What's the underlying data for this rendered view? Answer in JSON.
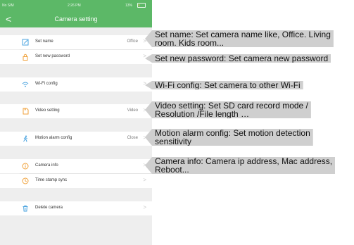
{
  "status_bar": {
    "carrier": "No SIM",
    "time": "2:26 PM",
    "battery": "13%",
    "battery_level": 0.13
  },
  "nav": {
    "back": "<",
    "title": "Camera setting"
  },
  "rows": [
    {
      "icon": "edit-icon",
      "label": "Set name",
      "value": "Office"
    },
    {
      "icon": "lock-icon",
      "label": "Set new password",
      "value": ""
    },
    {
      "icon": "wifi-icon",
      "label": "Wi-Fi config",
      "value": ""
    },
    {
      "icon": "sd-card-icon",
      "label": "Video setting",
      "value": "Video"
    },
    {
      "icon": "motion-icon",
      "label": "Motion alarm config",
      "value": "Close"
    },
    {
      "icon": "info-icon",
      "label": "Camera info",
      "value": ""
    },
    {
      "icon": "clock-icon",
      "label": "Time stamp sync",
      "value": ""
    },
    {
      "icon": "trash-icon",
      "label": "Delete camera",
      "value": ""
    }
  ],
  "chevron": ">",
  "callouts": [
    {
      "line1": "Set name:  Set camera name like, Office. Living",
      "line2": "room. Kids room..."
    },
    {
      "line1": "Set new password: Set camera new password",
      "line2": ""
    },
    {
      "line1": "Wi-Fi config:  Set camera to other Wi-Fi",
      "line2": ""
    },
    {
      "line1": "Video setting:  Set SD card record mode /",
      "line2": "Resolution /File length …"
    },
    {
      "line1": "Motion alarm config:  Set motion detection",
      "line2": "sensitivity"
    },
    {
      "line1": "Camera info: Camera ip address, Mac address,",
      "line2": "Reboot..."
    }
  ],
  "colors": {
    "nav": "#5cb867",
    "accent_icon": "#f0a23b",
    "wifi_icon": "#4aa3df",
    "callout_bg": "#cfcfcf"
  }
}
